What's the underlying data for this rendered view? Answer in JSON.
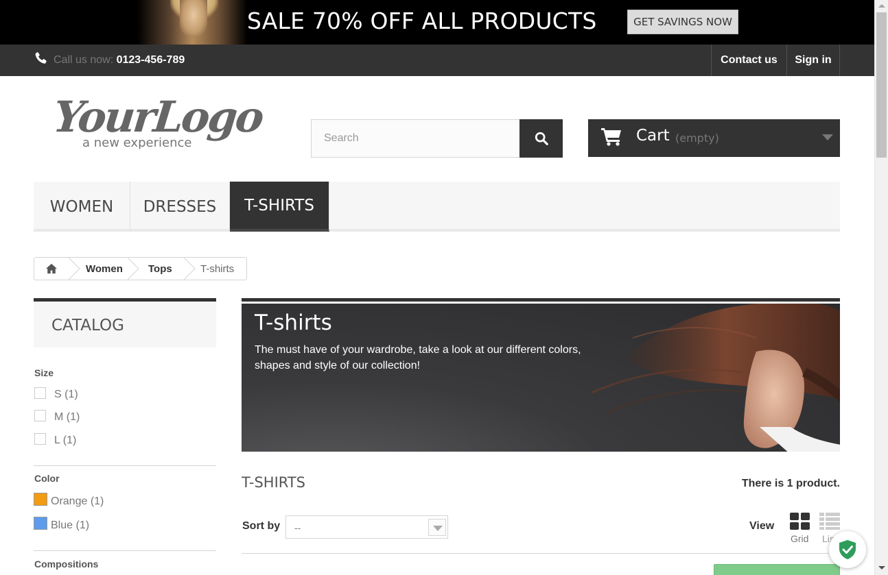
{
  "banner": {
    "title": "SALE 70% OFF ALL PRODUCTS",
    "button_label": "GET SAVINGS NOW"
  },
  "navbar": {
    "call_label": "Call us now:",
    "phone": "0123-456-789",
    "contact_label": "Contact us",
    "signin_label": "Sign in"
  },
  "logo": {
    "main": "YourLogo",
    "tagline": "a new experience"
  },
  "search": {
    "placeholder": "Search",
    "value": ""
  },
  "cart": {
    "label": "Cart",
    "status": "(empty)"
  },
  "menu": {
    "items": [
      {
        "label": "WOMEN"
      },
      {
        "label": "DRESSES"
      },
      {
        "label": "T-SHIRTS",
        "active": true
      }
    ]
  },
  "breadcrumb": {
    "items": [
      "Women",
      "Tops",
      "T-shirts"
    ]
  },
  "sidebar": {
    "catalog_title": "CATALOG",
    "size": {
      "title": "Size",
      "options": [
        {
          "label": "S",
          "count": "(1)"
        },
        {
          "label": "M",
          "count": "(1)"
        },
        {
          "label": "L",
          "count": "(1)"
        }
      ]
    },
    "color": {
      "title": "Color",
      "options": [
        {
          "label": "Orange",
          "count": "(1)",
          "hex": "#F39C11"
        },
        {
          "label": "Blue",
          "count": "(1)",
          "hex": "#5D9CEC"
        }
      ]
    },
    "compositions_title": "Compositions"
  },
  "category": {
    "title": "T-shirts",
    "description": "The must have of your wardrobe, take a look at our different colors, shapes and style of our collection!"
  },
  "listing": {
    "title": "T-SHIRTS",
    "count_text": "There is 1 product.",
    "sort_label": "Sort by",
    "sort_value": "--",
    "view_label": "View",
    "grid_label": "Grid",
    "list_label": "List"
  },
  "colors": {
    "dark": "#333333",
    "accent_green": "#7ECB8A"
  }
}
